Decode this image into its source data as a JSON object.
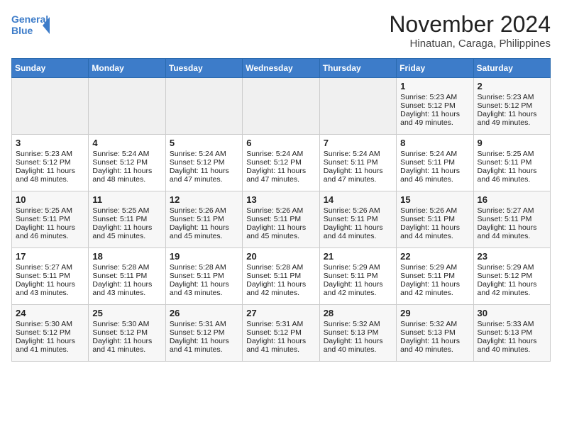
{
  "header": {
    "logo_line1": "General",
    "logo_line2": "Blue",
    "title": "November 2024",
    "subtitle": "Hinatuan, Caraga, Philippines"
  },
  "days_of_week": [
    "Sunday",
    "Monday",
    "Tuesday",
    "Wednesday",
    "Thursday",
    "Friday",
    "Saturday"
  ],
  "weeks": [
    [
      {
        "day": "",
        "info": ""
      },
      {
        "day": "",
        "info": ""
      },
      {
        "day": "",
        "info": ""
      },
      {
        "day": "",
        "info": ""
      },
      {
        "day": "",
        "info": ""
      },
      {
        "day": "1",
        "sunrise": "Sunrise: 5:23 AM",
        "sunset": "Sunset: 5:12 PM",
        "daylight": "Daylight: 11 hours and 49 minutes."
      },
      {
        "day": "2",
        "sunrise": "Sunrise: 5:23 AM",
        "sunset": "Sunset: 5:12 PM",
        "daylight": "Daylight: 11 hours and 49 minutes."
      }
    ],
    [
      {
        "day": "3",
        "sunrise": "Sunrise: 5:23 AM",
        "sunset": "Sunset: 5:12 PM",
        "daylight": "Daylight: 11 hours and 48 minutes."
      },
      {
        "day": "4",
        "sunrise": "Sunrise: 5:24 AM",
        "sunset": "Sunset: 5:12 PM",
        "daylight": "Daylight: 11 hours and 48 minutes."
      },
      {
        "day": "5",
        "sunrise": "Sunrise: 5:24 AM",
        "sunset": "Sunset: 5:12 PM",
        "daylight": "Daylight: 11 hours and 47 minutes."
      },
      {
        "day": "6",
        "sunrise": "Sunrise: 5:24 AM",
        "sunset": "Sunset: 5:12 PM",
        "daylight": "Daylight: 11 hours and 47 minutes."
      },
      {
        "day": "7",
        "sunrise": "Sunrise: 5:24 AM",
        "sunset": "Sunset: 5:11 PM",
        "daylight": "Daylight: 11 hours and 47 minutes."
      },
      {
        "day": "8",
        "sunrise": "Sunrise: 5:24 AM",
        "sunset": "Sunset: 5:11 PM",
        "daylight": "Daylight: 11 hours and 46 minutes."
      },
      {
        "day": "9",
        "sunrise": "Sunrise: 5:25 AM",
        "sunset": "Sunset: 5:11 PM",
        "daylight": "Daylight: 11 hours and 46 minutes."
      }
    ],
    [
      {
        "day": "10",
        "sunrise": "Sunrise: 5:25 AM",
        "sunset": "Sunset: 5:11 PM",
        "daylight": "Daylight: 11 hours and 46 minutes."
      },
      {
        "day": "11",
        "sunrise": "Sunrise: 5:25 AM",
        "sunset": "Sunset: 5:11 PM",
        "daylight": "Daylight: 11 hours and 45 minutes."
      },
      {
        "day": "12",
        "sunrise": "Sunrise: 5:26 AM",
        "sunset": "Sunset: 5:11 PM",
        "daylight": "Daylight: 11 hours and 45 minutes."
      },
      {
        "day": "13",
        "sunrise": "Sunrise: 5:26 AM",
        "sunset": "Sunset: 5:11 PM",
        "daylight": "Daylight: 11 hours and 45 minutes."
      },
      {
        "day": "14",
        "sunrise": "Sunrise: 5:26 AM",
        "sunset": "Sunset: 5:11 PM",
        "daylight": "Daylight: 11 hours and 44 minutes."
      },
      {
        "day": "15",
        "sunrise": "Sunrise: 5:26 AM",
        "sunset": "Sunset: 5:11 PM",
        "daylight": "Daylight: 11 hours and 44 minutes."
      },
      {
        "day": "16",
        "sunrise": "Sunrise: 5:27 AM",
        "sunset": "Sunset: 5:11 PM",
        "daylight": "Daylight: 11 hours and 44 minutes."
      }
    ],
    [
      {
        "day": "17",
        "sunrise": "Sunrise: 5:27 AM",
        "sunset": "Sunset: 5:11 PM",
        "daylight": "Daylight: 11 hours and 43 minutes."
      },
      {
        "day": "18",
        "sunrise": "Sunrise: 5:28 AM",
        "sunset": "Sunset: 5:11 PM",
        "daylight": "Daylight: 11 hours and 43 minutes."
      },
      {
        "day": "19",
        "sunrise": "Sunrise: 5:28 AM",
        "sunset": "Sunset: 5:11 PM",
        "daylight": "Daylight: 11 hours and 43 minutes."
      },
      {
        "day": "20",
        "sunrise": "Sunrise: 5:28 AM",
        "sunset": "Sunset: 5:11 PM",
        "daylight": "Daylight: 11 hours and 42 minutes."
      },
      {
        "day": "21",
        "sunrise": "Sunrise: 5:29 AM",
        "sunset": "Sunset: 5:11 PM",
        "daylight": "Daylight: 11 hours and 42 minutes."
      },
      {
        "day": "22",
        "sunrise": "Sunrise: 5:29 AM",
        "sunset": "Sunset: 5:11 PM",
        "daylight": "Daylight: 11 hours and 42 minutes."
      },
      {
        "day": "23",
        "sunrise": "Sunrise: 5:29 AM",
        "sunset": "Sunset: 5:12 PM",
        "daylight": "Daylight: 11 hours and 42 minutes."
      }
    ],
    [
      {
        "day": "24",
        "sunrise": "Sunrise: 5:30 AM",
        "sunset": "Sunset: 5:12 PM",
        "daylight": "Daylight: 11 hours and 41 minutes."
      },
      {
        "day": "25",
        "sunrise": "Sunrise: 5:30 AM",
        "sunset": "Sunset: 5:12 PM",
        "daylight": "Daylight: 11 hours and 41 minutes."
      },
      {
        "day": "26",
        "sunrise": "Sunrise: 5:31 AM",
        "sunset": "Sunset: 5:12 PM",
        "daylight": "Daylight: 11 hours and 41 minutes."
      },
      {
        "day": "27",
        "sunrise": "Sunrise: 5:31 AM",
        "sunset": "Sunset: 5:12 PM",
        "daylight": "Daylight: 11 hours and 41 minutes."
      },
      {
        "day": "28",
        "sunrise": "Sunrise: 5:32 AM",
        "sunset": "Sunset: 5:13 PM",
        "daylight": "Daylight: 11 hours and 40 minutes."
      },
      {
        "day": "29",
        "sunrise": "Sunrise: 5:32 AM",
        "sunset": "Sunset: 5:13 PM",
        "daylight": "Daylight: 11 hours and 40 minutes."
      },
      {
        "day": "30",
        "sunrise": "Sunrise: 5:33 AM",
        "sunset": "Sunset: 5:13 PM",
        "daylight": "Daylight: 11 hours and 40 minutes."
      }
    ]
  ]
}
